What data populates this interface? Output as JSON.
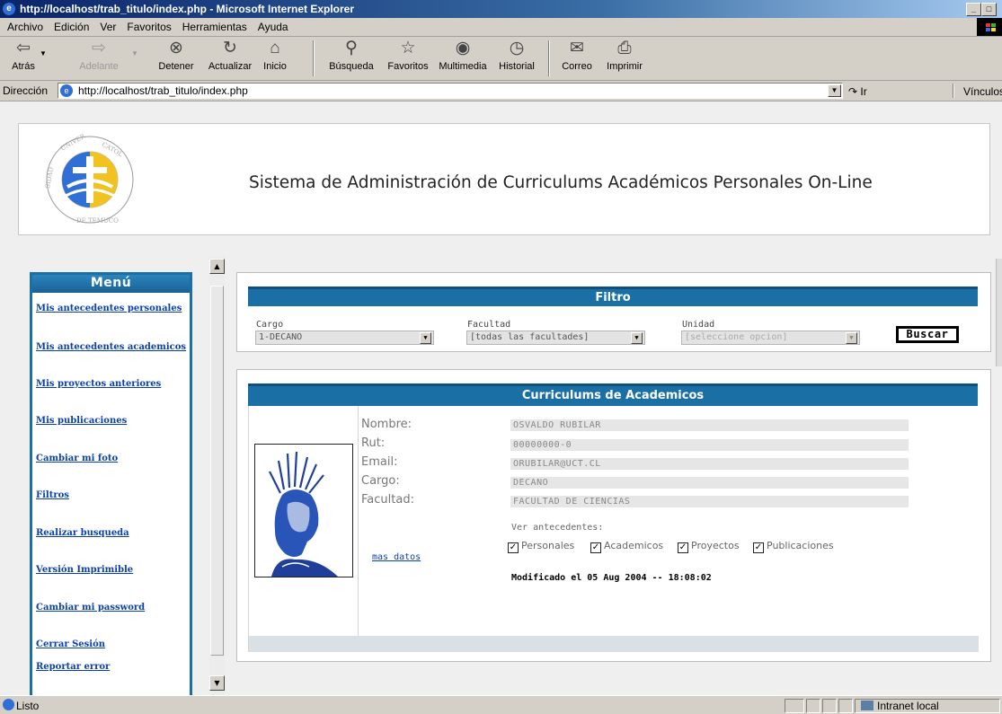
{
  "window": {
    "title": "http://localhost/trab_titulo/index.php - Microsoft Internet Explorer",
    "min_glyph": "_",
    "max_glyph": "□"
  },
  "menubar": [
    "Archivo",
    "Edición",
    "Ver",
    "Favoritos",
    "Herramientas",
    "Ayuda"
  ],
  "toolbar": {
    "back": "Atrás",
    "forward": "Adelante",
    "stop": "Detener",
    "refresh": "Actualizar",
    "home": "Inicio",
    "search": "Búsqueda",
    "favorites": "Favoritos",
    "media": "Multimedia",
    "history": "Historial",
    "mail": "Correo",
    "print": "Imprimir"
  },
  "address": {
    "label": "Dirección",
    "url": "http://localhost/trab_titulo/index.php",
    "go": "Ir",
    "links": "Vínculos"
  },
  "page": {
    "title": "Sistema de Administración de Curriculums Académicos Personales On-Line",
    "menu": {
      "title": "Menú",
      "items": [
        "Mis antecedentes personales",
        "Mis antecedentes academicos",
        "Mis proyectos anteriores",
        "Mis publicaciones",
        "Cambiar mi foto",
        "Filtros",
        "Realizar busqueda",
        "Versión Imprimible",
        "Cambiar mi password",
        "Cerrar Sesión",
        "Reportar error"
      ]
    },
    "filter": {
      "title": "Filtro",
      "cargo_label": "Cargo",
      "cargo_value": "1-DECANO",
      "facultad_label": "Facultad",
      "facultad_value": "[todas las facultades]",
      "unidad_label": "Unidad",
      "unidad_value": "[seleccione opcion]",
      "button": "Buscar"
    },
    "cv": {
      "title": "Curriculums de Academicos",
      "labels": {
        "nombre": "Nombre:",
        "rut": "Rut:",
        "email": "Email:",
        "cargo": "Cargo:",
        "facultad": "Facultad:"
      },
      "values": {
        "nombre": "OSVALDO RUBILAR",
        "rut": "00000000-0",
        "email": "ORUBILAR@UCT.CL",
        "cargo": "DECANO",
        "facultad": "FACULTAD DE CIENCIAS"
      },
      "ver_label": "Ver antecedentes:",
      "checks": [
        {
          "label": "Personales",
          "checked": true
        },
        {
          "label": "Academicos",
          "checked": true
        },
        {
          "label": "Proyectos",
          "checked": true
        },
        {
          "label": "Publicaciones",
          "checked": true
        }
      ],
      "mas_datos": "mas datos",
      "modified": "Modificado el 05 Aug 2004 -- 18:08:02"
    }
  },
  "status": {
    "text": "Listo",
    "zone": "Intranet local"
  },
  "colors": {
    "accent_blue": "#1a6fa5",
    "link_blue": "#0a3fb0"
  }
}
